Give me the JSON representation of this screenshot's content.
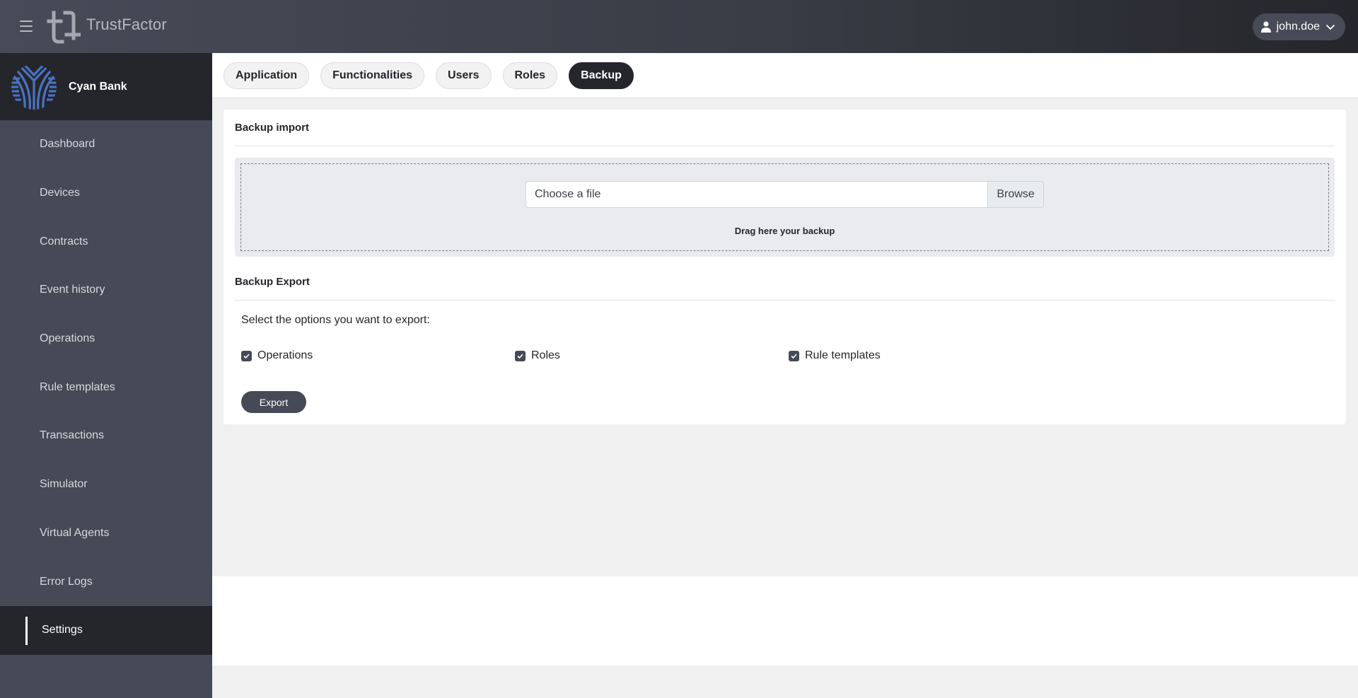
{
  "app": {
    "name": "TrustFactor",
    "logo_icon": "trustfactor-logo-icon",
    "menu_icon": "hamburger-icon"
  },
  "user": {
    "name": "john.doe",
    "icon": "user-icon",
    "dropdown_icon": "chevron-down-icon"
  },
  "org": {
    "name": "Cyan Bank",
    "logo_icon": "cyan-bank-logo-icon",
    "accent_color": "#4a72c4"
  },
  "sidebar": {
    "items": [
      {
        "label": "Dashboard",
        "active": false
      },
      {
        "label": "Devices",
        "active": false
      },
      {
        "label": "Contracts",
        "active": false
      },
      {
        "label": "Event history",
        "active": false
      },
      {
        "label": "Operations",
        "active": false
      },
      {
        "label": "Rule templates",
        "active": false
      },
      {
        "label": "Transactions",
        "active": false
      },
      {
        "label": "Simulator",
        "active": false
      },
      {
        "label": "Virtual Agents",
        "active": false
      },
      {
        "label": "Error Logs",
        "active": false
      },
      {
        "label": "Settings",
        "active": true
      }
    ]
  },
  "tabs": [
    {
      "label": "Application",
      "active": false
    },
    {
      "label": "Functionalities",
      "active": false
    },
    {
      "label": "Users",
      "active": false
    },
    {
      "label": "Roles",
      "active": false
    },
    {
      "label": "Backup",
      "active": true
    }
  ],
  "backup_import": {
    "title": "Backup import",
    "file_placeholder": "Choose a file",
    "browse_label": "Browse",
    "drag_hint": "Drag here your backup"
  },
  "backup_export": {
    "title": "Backup Export",
    "description": "Select the options you want to export:",
    "options": [
      {
        "label": "Operations",
        "checked": true
      },
      {
        "label": "Roles",
        "checked": true
      },
      {
        "label": "Rule templates",
        "checked": true
      }
    ],
    "export_label": "Export"
  },
  "colors": {
    "header_dark": "#25262b",
    "sidebar_bg": "#464a56",
    "primary_button": "#464a56"
  }
}
